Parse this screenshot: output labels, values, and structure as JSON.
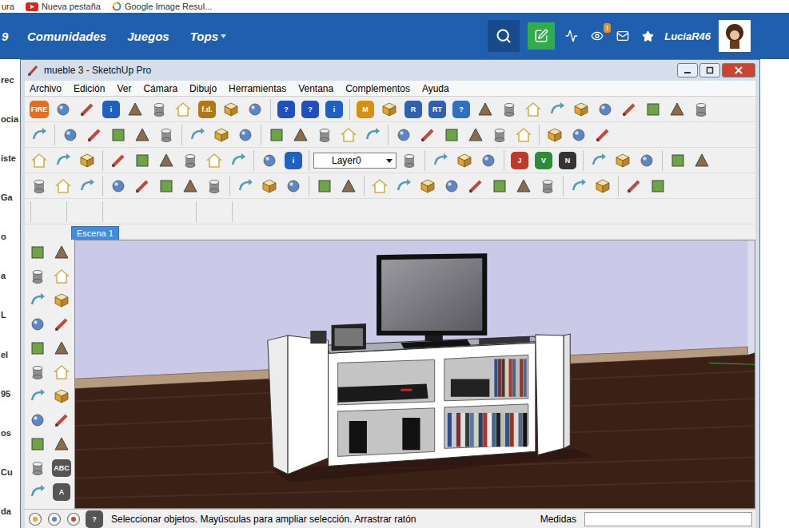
{
  "bookmarks": [
    {
      "label": "ura",
      "kind": "plain"
    },
    {
      "label": "Nueva pestaña",
      "kind": "youtube"
    },
    {
      "label": "Google Image Resul...",
      "kind": "google"
    }
  ],
  "site_header": {
    "logo_fragment": "9",
    "nav": [
      {
        "label": "Comunidades",
        "has_caret": false
      },
      {
        "label": "Juegos",
        "has_caret": false
      },
      {
        "label": "Tops",
        "has_caret": true
      }
    ],
    "notification_badge": "!",
    "username": "LuciaR46"
  },
  "background_page": {
    "fragments": [
      "rec",
      "ocia",
      "iste",
      "Ga",
      "o",
      "a",
      "L",
      "el",
      "95",
      "os",
      "Cu",
      "da"
    ]
  },
  "window": {
    "title": "mueble 3 - SketchUp Pro"
  },
  "menu": [
    "Archivo",
    "Edición",
    "Ver",
    "Cámara",
    "Dibujo",
    "Herramientas",
    "Ventana",
    "Complementos",
    "Ayuda"
  ],
  "toolbars": [
    [
      {
        "kind": "glyph",
        "label": "FIRE",
        "color": "#e07020"
      },
      {
        "kind": "icon"
      },
      {
        "kind": "icon"
      },
      {
        "kind": "glyph",
        "label": "i",
        "color": "#2060c0"
      },
      {
        "kind": "icon"
      },
      {
        "kind": "icon"
      },
      {
        "kind": "icon"
      },
      {
        "kind": "glyph",
        "label": "f.d.",
        "color": "#b07818"
      },
      {
        "kind": "icon"
      },
      {
        "kind": "icon"
      },
      {
        "kind": "sep"
      },
      {
        "kind": "glyph",
        "label": "?",
        "color": "#2050c0"
      },
      {
        "kind": "glyph",
        "label": "?",
        "color": "#2050c0"
      },
      {
        "kind": "glyph",
        "label": "i",
        "color": "#2060c0"
      },
      {
        "kind": "sep"
      },
      {
        "kind": "glyph",
        "label": "M",
        "color": "#d89010"
      },
      {
        "kind": "icon"
      },
      {
        "kind": "glyph",
        "label": "R",
        "color": "#3060b0"
      },
      {
        "kind": "glyph",
        "label": "RT",
        "color": "#3060b0"
      },
      {
        "kind": "glyph",
        "label": "?",
        "color": "#3070c0"
      },
      {
        "kind": "icon"
      },
      {
        "kind": "icon"
      },
      {
        "kind": "icon"
      },
      {
        "kind": "icon"
      },
      {
        "kind": "icon"
      },
      {
        "kind": "icon"
      },
      {
        "kind": "icon"
      },
      {
        "kind": "icon"
      },
      {
        "kind": "icon"
      },
      {
        "kind": "icon"
      }
    ],
    [
      {
        "kind": "icon"
      },
      {
        "kind": "sep"
      },
      {
        "kind": "icon"
      },
      {
        "kind": "icon"
      },
      {
        "kind": "icon"
      },
      {
        "kind": "icon"
      },
      {
        "kind": "icon"
      },
      {
        "kind": "sep"
      },
      {
        "kind": "icon"
      },
      {
        "kind": "icon"
      },
      {
        "kind": "icon"
      },
      {
        "kind": "sep"
      },
      {
        "kind": "icon"
      },
      {
        "kind": "icon"
      },
      {
        "kind": "icon"
      },
      {
        "kind": "icon"
      },
      {
        "kind": "icon"
      },
      {
        "kind": "sep"
      },
      {
        "kind": "icon"
      },
      {
        "kind": "icon"
      },
      {
        "kind": "icon"
      },
      {
        "kind": "icon"
      },
      {
        "kind": "icon"
      },
      {
        "kind": "icon"
      },
      {
        "kind": "sep"
      },
      {
        "kind": "icon"
      },
      {
        "kind": "icon"
      },
      {
        "kind": "icon"
      }
    ],
    [
      {
        "kind": "icon"
      },
      {
        "kind": "icon"
      },
      {
        "kind": "icon"
      },
      {
        "kind": "sep"
      },
      {
        "kind": "icon"
      },
      {
        "kind": "icon"
      },
      {
        "kind": "icon"
      },
      {
        "kind": "icon"
      },
      {
        "kind": "icon"
      },
      {
        "kind": "icon"
      },
      {
        "kind": "sep"
      },
      {
        "kind": "icon"
      },
      {
        "kind": "glyph",
        "label": "i",
        "color": "#2060c0"
      },
      {
        "kind": "sep"
      },
      {
        "kind": "dropdown",
        "label": "Layer0"
      },
      {
        "kind": "icon"
      },
      {
        "kind": "sep"
      },
      {
        "kind": "icon"
      },
      {
        "kind": "icon"
      },
      {
        "kind": "icon"
      },
      {
        "kind": "sep"
      },
      {
        "kind": "glyph",
        "label": "J",
        "color": "#c0392b"
      },
      {
        "kind": "glyph",
        "label": "V",
        "color": "#2e8b3a"
      },
      {
        "kind": "glyph",
        "label": "N",
        "color": "#333333"
      },
      {
        "kind": "sep"
      },
      {
        "kind": "icon"
      },
      {
        "kind": "icon"
      },
      {
        "kind": "icon"
      },
      {
        "kind": "sep"
      },
      {
        "kind": "icon"
      },
      {
        "kind": "icon"
      }
    ],
    [
      {
        "kind": "icon"
      },
      {
        "kind": "icon"
      },
      {
        "kind": "icon"
      },
      {
        "kind": "sep"
      },
      {
        "kind": "icon"
      },
      {
        "kind": "icon"
      },
      {
        "kind": "icon"
      },
      {
        "kind": "icon"
      },
      {
        "kind": "icon"
      },
      {
        "kind": "sep"
      },
      {
        "kind": "icon"
      },
      {
        "kind": "icon"
      },
      {
        "kind": "icon"
      },
      {
        "kind": "sep"
      },
      {
        "kind": "icon"
      },
      {
        "kind": "icon"
      },
      {
        "kind": "sep"
      },
      {
        "kind": "icon"
      },
      {
        "kind": "icon"
      },
      {
        "kind": "icon"
      },
      {
        "kind": "icon"
      },
      {
        "kind": "icon"
      },
      {
        "kind": "icon"
      },
      {
        "kind": "icon"
      },
      {
        "kind": "icon"
      },
      {
        "kind": "sep"
      },
      {
        "kind": "icon"
      },
      {
        "kind": "icon"
      },
      {
        "kind": "sep"
      },
      {
        "kind": "icon"
      },
      {
        "kind": "icon"
      }
    ],
    [
      {
        "kind": "sep"
      },
      {
        "kind": "blank"
      },
      {
        "kind": "sep"
      },
      {
        "kind": "blank"
      },
      {
        "kind": "sep"
      },
      {
        "kind": "blank"
      },
      {
        "kind": "blank"
      },
      {
        "kind": "blank"
      },
      {
        "kind": "sep"
      },
      {
        "kind": "blank"
      },
      {
        "kind": "sep"
      }
    ]
  ],
  "scene_tabs": [
    {
      "label": "Escena 1",
      "selected": true
    }
  ],
  "left_toolbar": [
    {
      "kind": "icon"
    },
    {
      "kind": "icon"
    },
    {
      "kind": "icon"
    },
    {
      "kind": "icon"
    },
    {
      "kind": "icon"
    },
    {
      "kind": "icon"
    },
    {
      "kind": "icon"
    },
    {
      "kind": "icon"
    },
    {
      "kind": "icon"
    },
    {
      "kind": "icon"
    },
    {
      "kind": "icon"
    },
    {
      "kind": "icon"
    },
    {
      "kind": "icon"
    },
    {
      "kind": "icon"
    },
    {
      "kind": "icon"
    },
    {
      "kind": "icon"
    },
    {
      "kind": "icon"
    },
    {
      "kind": "icon"
    },
    {
      "kind": "icon"
    },
    {
      "kind": "glyph",
      "label": "ABC",
      "color": "#555555"
    },
    {
      "kind": "icon"
    },
    {
      "kind": "glyph",
      "label": "A",
      "color": "#555555"
    }
  ],
  "status_bar": {
    "help": "?",
    "message": "Seleccionar objetos. Mayúsculas para ampliar selección. Arrastrar ratón",
    "measure_label": "Medidas",
    "measure_value": ""
  }
}
